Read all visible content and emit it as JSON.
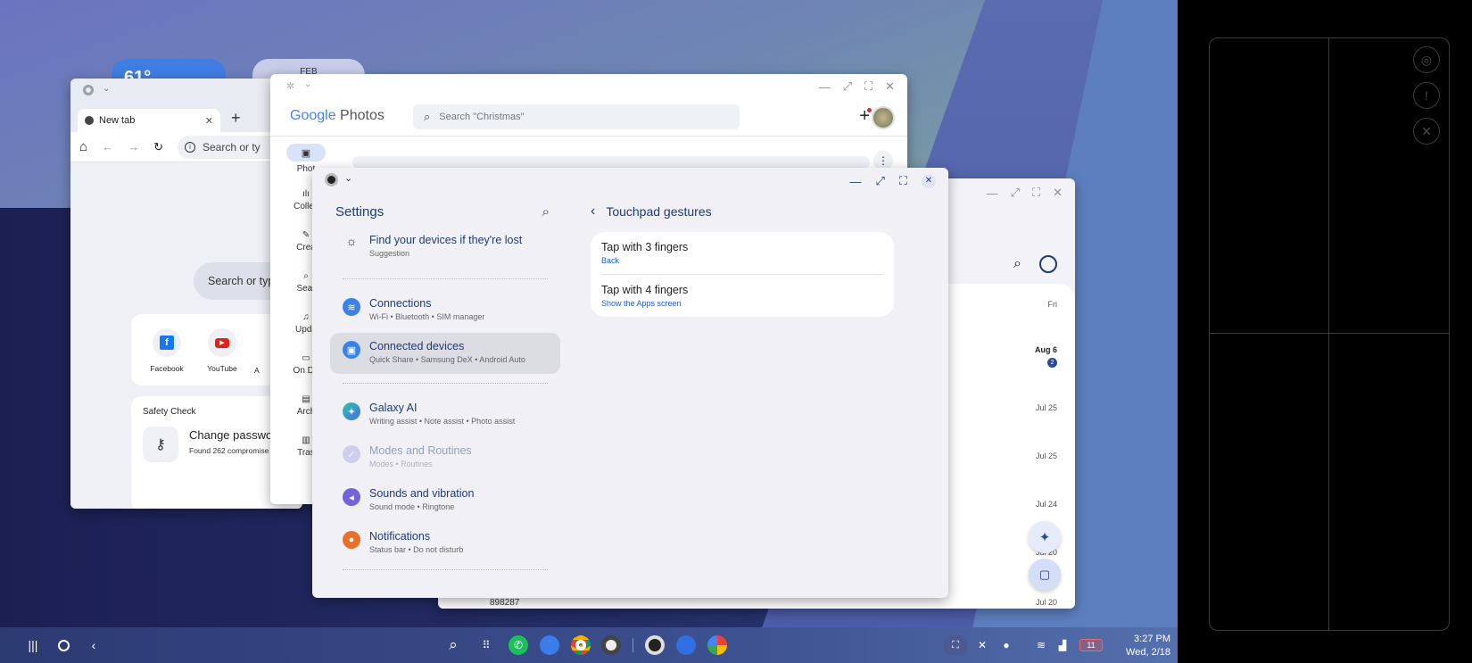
{
  "weather_widget": {
    "temp": "61°"
  },
  "calendar_widget": {
    "month": "FEB"
  },
  "chrome": {
    "tab_title": "New tab",
    "omnibox_placeholder": "Search or ty",
    "search_placeholder": "Search or typ",
    "shortcuts": [
      {
        "label": "Facebook"
      },
      {
        "label": "YouTube"
      },
      {
        "label": "A"
      }
    ],
    "safety_check": {
      "title": "Safety Check",
      "item_title": "Change passwo",
      "item_sub": "Found 262 compromise"
    }
  },
  "photos": {
    "logo_google": "Google",
    "logo_photos": "Photos",
    "search_placeholder": "Search \"Christmas\"",
    "nav": [
      {
        "label": "Phot"
      },
      {
        "label": "Collec"
      },
      {
        "label": "Crea"
      },
      {
        "label": "Sear"
      },
      {
        "label": "Upda"
      },
      {
        "label": "On De"
      },
      {
        "label": "Arch"
      },
      {
        "label": "Tras"
      }
    ]
  },
  "back_window": {
    "dates": [
      {
        "label": "Fri"
      },
      {
        "label": "Aug 6"
      },
      {
        "label": "Jul 25"
      },
      {
        "label": "Jul 25"
      },
      {
        "label": "Jul 24"
      },
      {
        "label": "Jul 20"
      },
      {
        "label": "Jul 20"
      }
    ],
    "badge": "2",
    "last_item": "898287"
  },
  "settings": {
    "title": "Settings",
    "suggestion": {
      "title": "Find your devices if they're lost",
      "sub": "Suggestion"
    },
    "items": [
      {
        "title": "Connections",
        "sub": "Wi-Fi  •  Bluetooth  •  SIM manager",
        "color": "#3b82e8"
      },
      {
        "title": "Connected devices",
        "sub": "Quick Share  •  Samsung DeX  •  Android Auto",
        "color": "#3b82e8"
      },
      {
        "title": "Galaxy AI",
        "sub": "Writing assist  •  Note assist  •  Photo assist",
        "color": "#33a0e0"
      },
      {
        "title": "Modes and Routines",
        "sub": "Modes  •  Routines",
        "color": "#a9a5e6"
      },
      {
        "title": "Sounds and vibration",
        "sub": "Sound mode  •  Ringtone",
        "color": "#7563d9"
      },
      {
        "title": "Notifications",
        "sub": "Status bar  •  Do not disturb",
        "color": "#e8702a"
      }
    ],
    "detail_title": "Touchpad gestures",
    "gestures": [
      {
        "title": "Tap with 3 fingers",
        "sub": "Back"
      },
      {
        "title": "Tap with 4 fingers",
        "sub": "Show the Apps screen"
      }
    ]
  },
  "status": {
    "time": "3:27 PM",
    "date": "Wed, 2/18",
    "battery": "11"
  }
}
